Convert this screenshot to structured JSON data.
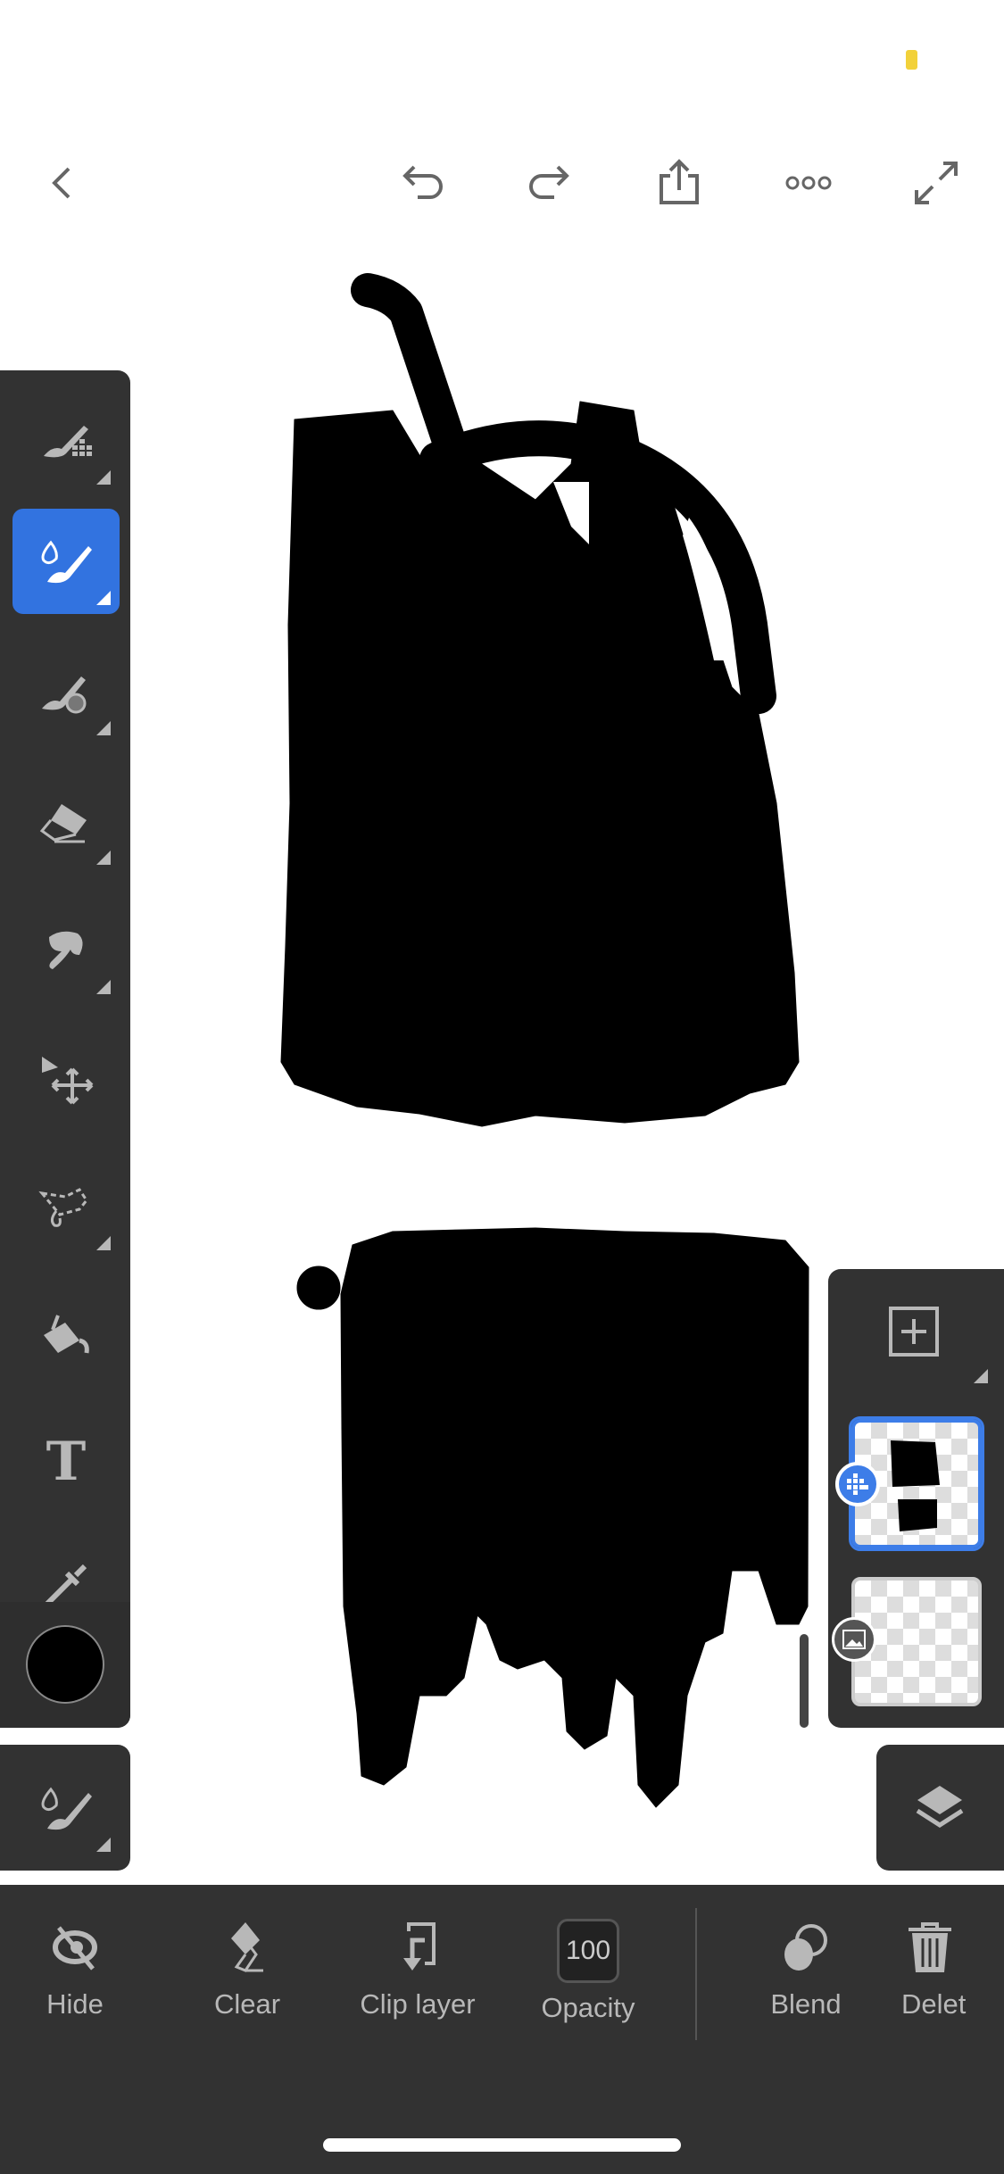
{
  "status_bar": {
    "indicator_color": "#f2d13a"
  },
  "top_bar": {
    "icons": [
      "back-chevron-icon",
      "undo-icon",
      "redo-icon",
      "share-icon",
      "more-icon",
      "expand-icon"
    ]
  },
  "toolbar": {
    "tools": [
      {
        "name": "pixel-brush",
        "selected": false
      },
      {
        "name": "watercolor-brush",
        "selected": true
      },
      {
        "name": "blend-brush",
        "selected": false
      },
      {
        "name": "eraser",
        "selected": false
      },
      {
        "name": "smudge",
        "selected": false
      },
      {
        "name": "transform",
        "selected": false
      },
      {
        "name": "lasso-select",
        "selected": false
      },
      {
        "name": "fill",
        "selected": false
      },
      {
        "name": "text",
        "selected": false
      },
      {
        "name": "eyedropper",
        "selected": false
      }
    ],
    "text_tool_glyph": "T",
    "current_color": "#000000",
    "accent": "#3273e0"
  },
  "layers": {
    "items": [
      {
        "type": "drawing",
        "selected": true
      },
      {
        "type": "image",
        "selected": false
      }
    ]
  },
  "bottom_bar": {
    "hide": "Hide",
    "clear": "Clear",
    "clip_layer": "Clip layer",
    "opacity_value": "100",
    "opacity": "Opacity",
    "blend": "Blend",
    "delete": "Delet"
  }
}
